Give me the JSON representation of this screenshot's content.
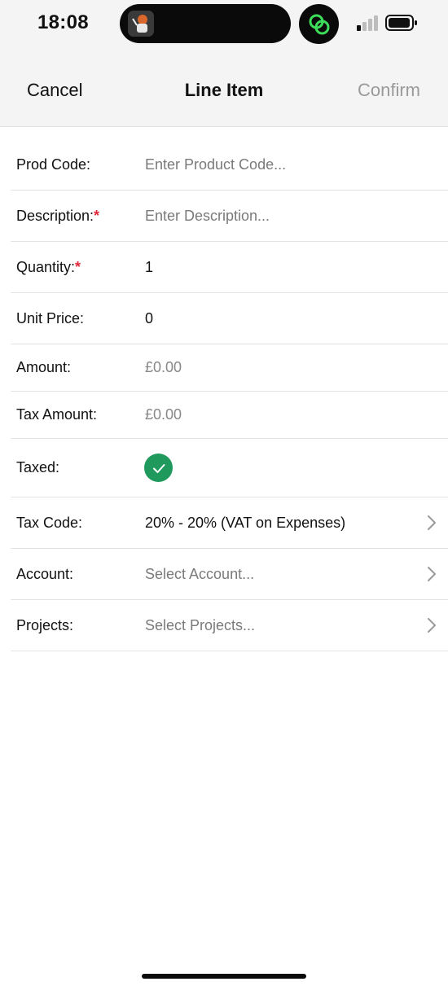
{
  "status_bar": {
    "time": "18:08",
    "signal_icon": "cellular-signal-icon",
    "battery_icon": "battery-icon",
    "app_icon": "linked-rings-icon",
    "app_icon_color": "#3ddc5a"
  },
  "nav": {
    "cancel_label": "Cancel",
    "title": "Line Item",
    "confirm_label": "Confirm"
  },
  "form": {
    "prod_code": {
      "label": "Prod Code:",
      "placeholder": "Enter Product Code..."
    },
    "description": {
      "label": "Description:",
      "required_mark": "*",
      "placeholder": "Enter Description..."
    },
    "quantity": {
      "label": "Quantity:",
      "required_mark": "*",
      "value": "1"
    },
    "unit_price": {
      "label": "Unit Price:",
      "value": "0"
    },
    "amount": {
      "label": "Amount:",
      "value": "£0.00"
    },
    "tax_amount": {
      "label": "Tax Amount:",
      "value": "£0.00"
    },
    "taxed": {
      "label": "Taxed:",
      "checked": true,
      "icon": "checkmark-icon"
    },
    "tax_code": {
      "label": "Tax Code:",
      "value": "20% - 20% (VAT on Expenses)"
    },
    "account": {
      "label": "Account:",
      "placeholder": "Select Account..."
    },
    "projects": {
      "label": "Projects:",
      "placeholder": "Select Projects..."
    }
  },
  "colors": {
    "accent_check": "#1f9a5c",
    "required": "#e0283a",
    "confirm_disabled": "#9a9a9a"
  }
}
